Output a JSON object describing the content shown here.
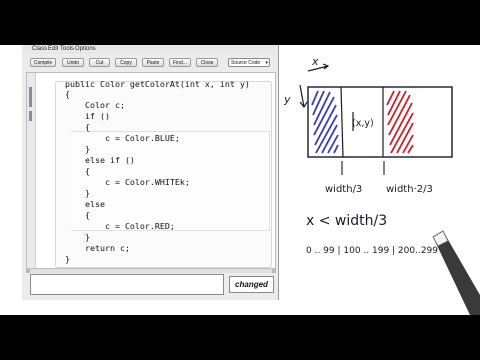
{
  "menu": {
    "items": [
      "Class",
      "Edit",
      "Tools",
      "Options"
    ]
  },
  "toolbar": {
    "buttons": [
      "Compile",
      "Undo",
      "Cut",
      "Copy",
      "Paste",
      "Find...",
      "Close"
    ],
    "view_select": "Source Code"
  },
  "code": {
    "lines": [
      "public Color getColorAt(int x, int y)",
      "{",
      "    Color c;",
      "    if ()",
      "    {",
      "        c = Color.BLUE;",
      "    }",
      "    else if ()",
      "    {",
      "        c = Color.WHITEk;",
      "    }",
      "    else",
      "    {",
      "        c = Color.RED;",
      "    }",
      "    return c;",
      "}"
    ]
  },
  "status": {
    "label": "changed"
  },
  "sketch": {
    "x_axis_label": "x",
    "y_axis_label": "y",
    "center_point_label": "(x,y)",
    "boundary_1_label": "width/3",
    "boundary_2_label": "width·2/3",
    "condition": "x < width/3",
    "ranges": "0 .. 99 | 100 .. 199 | 200..299",
    "colors": {
      "left_stripe": "#3b3bb0",
      "right_stripe": "#c8202a",
      "ink": "#1a1a2a"
    }
  }
}
